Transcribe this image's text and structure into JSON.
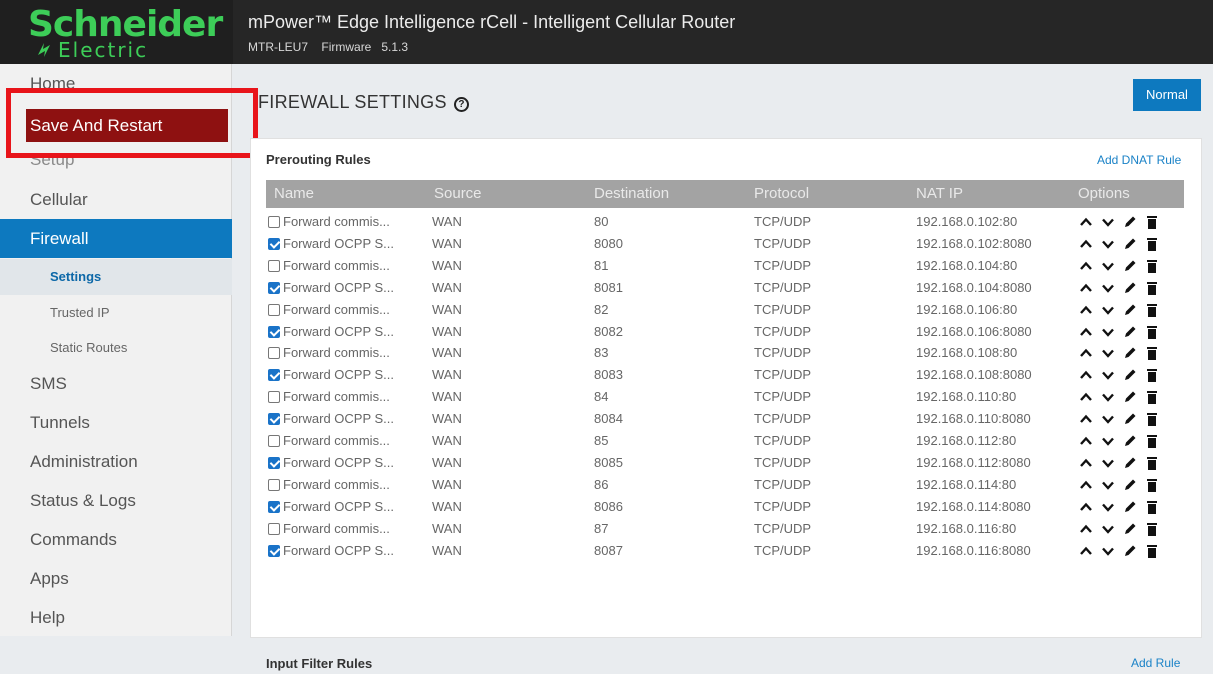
{
  "brand": {
    "line1": "Schneider",
    "line2": "Electric",
    "color": "#3dcd58"
  },
  "header": {
    "title": "mPower™ Edge Intelligence rCell - Intelligent Cellular Router",
    "model": "MTR-LEU7",
    "firmware_label": "Firmware",
    "firmware_version": "5.1.3"
  },
  "sidebar": {
    "home": "Home",
    "save_restart": "Save And Restart",
    "setup": "Setup",
    "cellular": "Cellular",
    "firewall": "Firewall",
    "firewall_sub": [
      "Settings",
      "Trusted IP",
      "Static Routes"
    ],
    "sms": "SMS",
    "tunnels": "Tunnels",
    "administration": "Administration",
    "status_logs": "Status & Logs",
    "commands": "Commands",
    "apps": "Apps",
    "help": "Help"
  },
  "main": {
    "page_title": "FIREWALL SETTINGS",
    "help_glyph": "?",
    "mode_button": "Normal",
    "prerouting_title": "Prerouting Rules",
    "add_dnat": "Add DNAT Rule",
    "input_title": "Input Filter Rules",
    "add_rule": "Add Rule"
  },
  "table": {
    "columns": [
      "Name",
      "Source",
      "Destination",
      "Protocol",
      "NAT IP",
      "Options"
    ],
    "rows": [
      {
        "checked": false,
        "name": "Forward commis...",
        "source": "WAN",
        "destination": "80",
        "protocol": "TCP/UDP",
        "nat_ip": "192.168.0.102:80"
      },
      {
        "checked": true,
        "name": "Forward OCPP S...",
        "source": "WAN",
        "destination": "8080",
        "protocol": "TCP/UDP",
        "nat_ip": "192.168.0.102:8080"
      },
      {
        "checked": false,
        "name": "Forward commis...",
        "source": "WAN",
        "destination": "81",
        "protocol": "TCP/UDP",
        "nat_ip": "192.168.0.104:80"
      },
      {
        "checked": true,
        "name": "Forward OCPP S...",
        "source": "WAN",
        "destination": "8081",
        "protocol": "TCP/UDP",
        "nat_ip": "192.168.0.104:8080"
      },
      {
        "checked": false,
        "name": "Forward commis...",
        "source": "WAN",
        "destination": "82",
        "protocol": "TCP/UDP",
        "nat_ip": "192.168.0.106:80"
      },
      {
        "checked": true,
        "name": "Forward OCPP S...",
        "source": "WAN",
        "destination": "8082",
        "protocol": "TCP/UDP",
        "nat_ip": "192.168.0.106:8080"
      },
      {
        "checked": false,
        "name": "Forward commis...",
        "source": "WAN",
        "destination": "83",
        "protocol": "TCP/UDP",
        "nat_ip": "192.168.0.108:80"
      },
      {
        "checked": true,
        "name": "Forward OCPP S...",
        "source": "WAN",
        "destination": "8083",
        "protocol": "TCP/UDP",
        "nat_ip": "192.168.0.108:8080"
      },
      {
        "checked": false,
        "name": "Forward commis...",
        "source": "WAN",
        "destination": "84",
        "protocol": "TCP/UDP",
        "nat_ip": "192.168.0.110:80"
      },
      {
        "checked": true,
        "name": "Forward OCPP S...",
        "source": "WAN",
        "destination": "8084",
        "protocol": "TCP/UDP",
        "nat_ip": "192.168.0.110:8080"
      },
      {
        "checked": false,
        "name": "Forward commis...",
        "source": "WAN",
        "destination": "85",
        "protocol": "TCP/UDP",
        "nat_ip": "192.168.0.112:80"
      },
      {
        "checked": true,
        "name": "Forward OCPP S...",
        "source": "WAN",
        "destination": "8085",
        "protocol": "TCP/UDP",
        "nat_ip": "192.168.0.112:8080"
      },
      {
        "checked": false,
        "name": "Forward commis...",
        "source": "WAN",
        "destination": "86",
        "protocol": "TCP/UDP",
        "nat_ip": "192.168.0.114:80"
      },
      {
        "checked": true,
        "name": "Forward OCPP S...",
        "source": "WAN",
        "destination": "8086",
        "protocol": "TCP/UDP",
        "nat_ip": "192.168.0.114:8080"
      },
      {
        "checked": false,
        "name": "Forward commis...",
        "source": "WAN",
        "destination": "87",
        "protocol": "TCP/UDP",
        "nat_ip": "192.168.0.116:80"
      },
      {
        "checked": true,
        "name": "Forward OCPP S...",
        "source": "WAN",
        "destination": "8087",
        "protocol": "TCP/UDP",
        "nat_ip": "192.168.0.116:8080"
      }
    ],
    "option_icons": [
      "move-up-icon",
      "move-down-icon",
      "pencil-edit-icon",
      "trash-delete-icon"
    ]
  },
  "colors": {
    "accent_blue": "#0d79bf",
    "save_red": "#8e1111",
    "highlight_red": "#e8141a",
    "header_bg": "#262626",
    "table_header": "#a3a3a3"
  }
}
